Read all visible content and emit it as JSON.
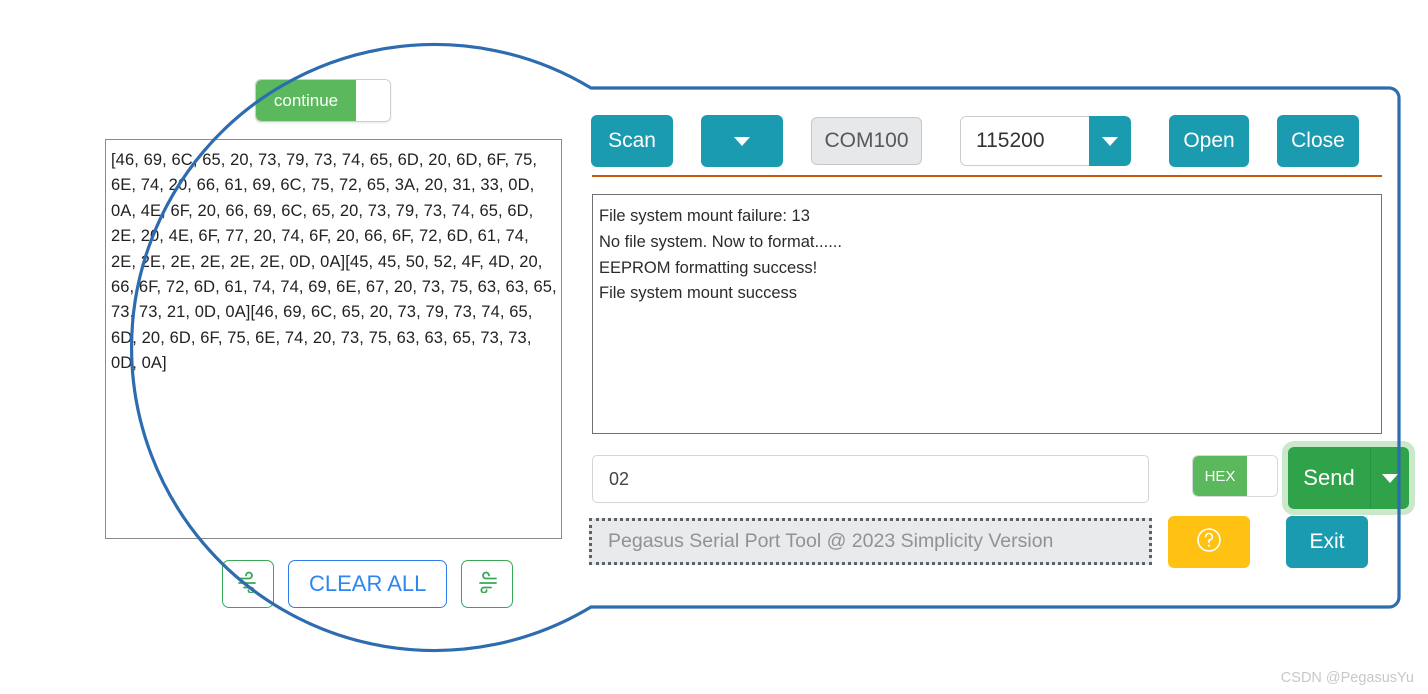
{
  "zoom_bubble": {
    "continue_toggle": {
      "label": "continue",
      "state": "on",
      "on_color": "#5cb85c"
    },
    "hex_log": {
      "text": "[46, 69, 6C, 65, 20, 73, 79, 73, 74, 65, 6D, 20, 6D, 6F, 75, 6E, 74, 20, 66, 61, 69, 6C, 75, 72, 65, 3A, 20, 31, 33, 0D, 0A, 4E, 6F, 20, 66, 69, 6C, 65, 20, 73, 79, 73, 74, 65, 6D, 2E, 20, 4E, 6F, 77, 20, 74, 6F, 20, 66, 6F, 72, 6D, 61, 74, 2E, 2E, 2E, 2E, 2E, 2E, 0D, 0A][45, 45, 50, 52, 4F, 4D, 20, 66, 6F, 72, 6D, 61, 74, 74, 69, 6E, 67, 20, 73, 75, 63, 63, 65, 73, 73, 21, 0D, 0A][46, 69, 6C, 65, 20, 73, 79, 73, 74, 65, 6D, 20, 6D, 6F, 75, 6E, 74, 20, 73, 75, 63, 63, 65, 73, 73, 0D, 0A]"
    },
    "buttons": {
      "clear_all_label": "CLEAR ALL",
      "left_icon_name": "wind-left-icon",
      "right_icon_name": "wind-right-icon",
      "accent_green": "#3aa757",
      "accent_blue": "#2f86f0"
    }
  },
  "app": {
    "toolbar": {
      "scan_label": "Scan",
      "port_dropdown_icon": "chevron-down-icon",
      "port_value": "COM100",
      "baud_value": "115200",
      "baud_dropdown_icon": "chevron-down-icon",
      "open_label": "Open",
      "close_label": "Close",
      "button_color": "#1b9bb0"
    },
    "separator_color": "#c55a11",
    "terminal": {
      "lines": [
        "File system mount failure: 13",
        "No file system. Now to format......",
        "EEPROM formatting success!",
        "File system mount success"
      ]
    },
    "send_row": {
      "input_value": "02",
      "hex_toggle_label": "HEX",
      "hex_toggle_state": "on",
      "send_label": "Send",
      "send_dropdown_icon": "chevron-down-icon",
      "send_color": "#30a34a"
    },
    "bottom_row": {
      "status_text": "Pegasus Serial Port Tool @ 2023 Simplicity Version",
      "help_icon": "question-circle-icon",
      "help_color": "#ffc112",
      "exit_label": "Exit",
      "exit_color": "#1b9bb0"
    }
  },
  "callout": {
    "outline_color": "#2e6cb0",
    "shape": "magnifier-circle-with-panel"
  },
  "watermark": {
    "text": "CSDN @PegasusYu"
  }
}
